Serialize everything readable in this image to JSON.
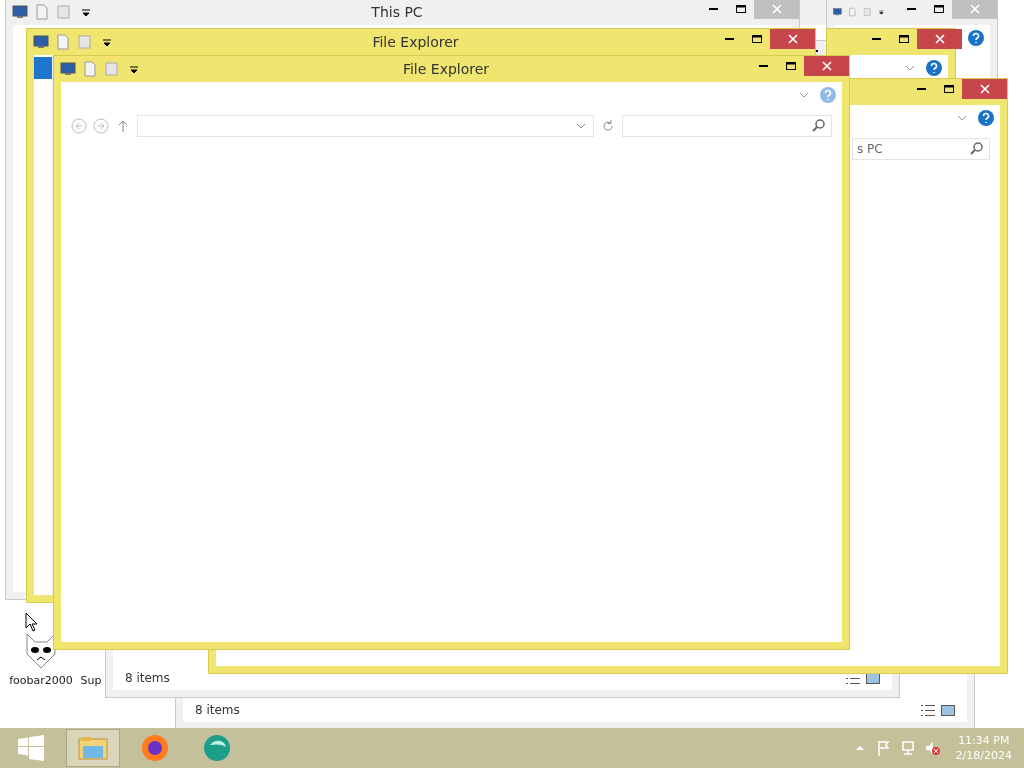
{
  "windows": [
    {
      "focused": false,
      "status": "8 items"
    },
    {
      "focused": false
    },
    {
      "focused": false,
      "status": "8 items"
    },
    {
      "focused": false,
      "title": "This PC"
    },
    {
      "focused": true,
      "title": "File Explorer"
    },
    {
      "focused": true
    },
    {
      "focused": true,
      "search": "s PC"
    },
    {
      "focused": true,
      "title": "File Explorer"
    }
  ],
  "desktop_icons": [
    {
      "label": "foobar2000"
    },
    {
      "label": "Sup"
    }
  ],
  "taskbar": {
    "items": [
      {
        "kind": "start",
        "selected": false
      },
      {
        "kind": "explorer",
        "selected": true
      },
      {
        "kind": "firefox",
        "selected": false
      },
      {
        "kind": "app",
        "selected": false
      }
    ],
    "tray": {
      "time": "11:34 PM",
      "date": "2/18/2024"
    }
  }
}
